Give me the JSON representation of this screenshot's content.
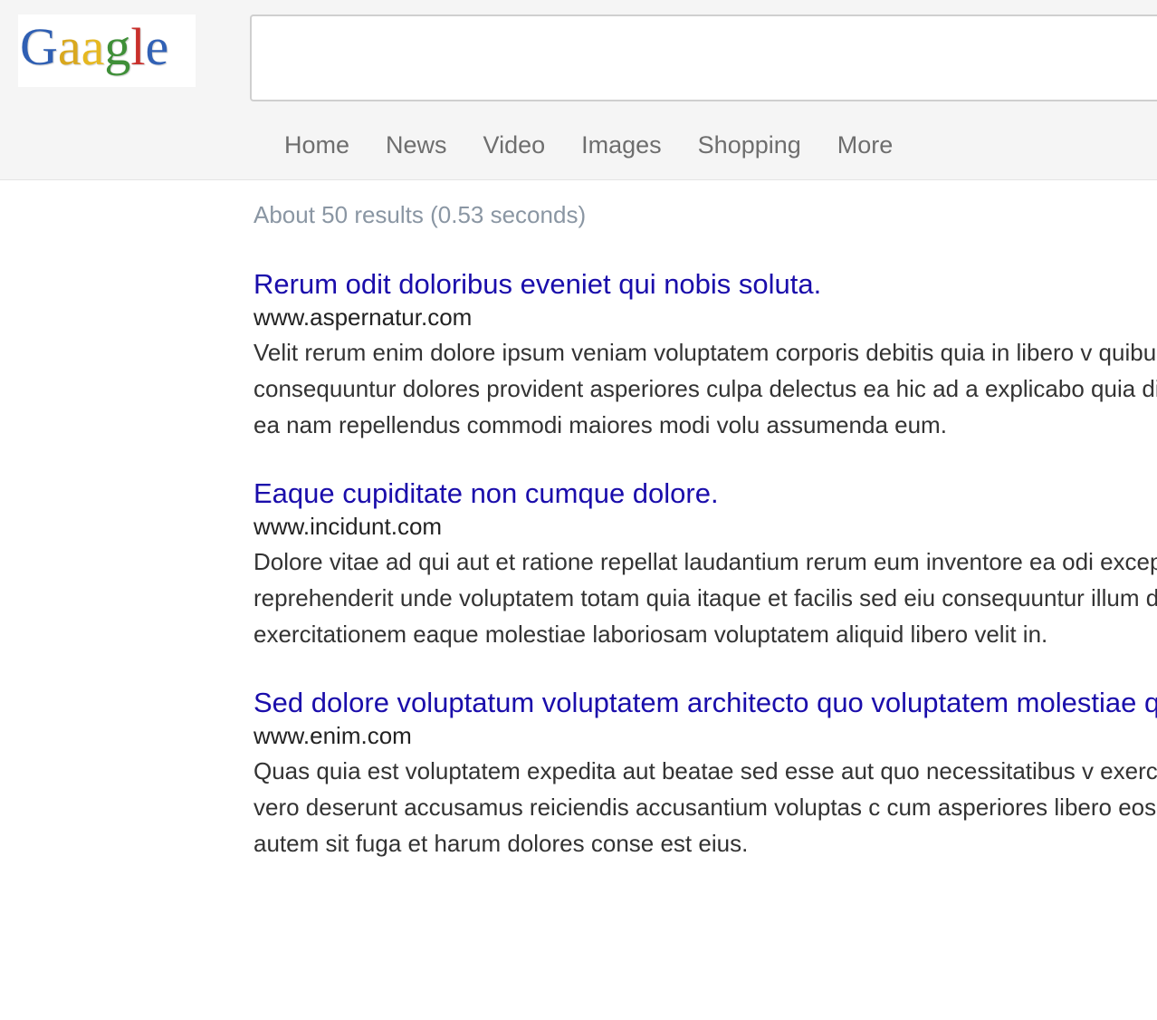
{
  "logo": {
    "letters": [
      {
        "char": "G",
        "color": "#2f5fb3"
      },
      {
        "char": "a",
        "color": "#d9a81e"
      },
      {
        "char": "a",
        "color": "#e6b820"
      },
      {
        "char": "g",
        "color": "#3f8f38"
      },
      {
        "char": "l",
        "color": "#c9302c"
      },
      {
        "char": "e",
        "color": "#3161b5"
      }
    ]
  },
  "search": {
    "value": "",
    "placeholder": ""
  },
  "nav": {
    "items": [
      "Home",
      "News",
      "Video",
      "Images",
      "Shopping",
      "More"
    ]
  },
  "stats": {
    "text": "About 50 results (0.53 seconds)"
  },
  "results": [
    {
      "title": "Rerum odit doloribus eveniet qui nobis soluta.",
      "url": "www.aspernatur.com",
      "snippet": "Velit rerum enim dolore ipsum veniam voluptatem corporis debitis quia in libero v quibusdam consequuntur dolores provident asperiores culpa delectus ea hic ad a explicabo quia dicta ut est vitae ea nam repellendus commodi maiores modi volu assumenda eum."
    },
    {
      "title": "Eaque cupiditate non cumque dolore.",
      "url": "www.incidunt.com",
      "snippet": "Dolore vitae ad qui aut et ratione repellat laudantium rerum eum inventore ea odi excepturi atque reprehenderit unde voluptatem totam quia itaque et facilis sed eiu consequuntur illum dolorum veniam exercitationem eaque molestiae laboriosam voluptatem aliquid libero velit in."
    },
    {
      "title": "Sed dolore voluptatum voluptatem architecto quo voluptatem molestiae quibusdam.",
      "url": "www.enim.com",
      "snippet": "Quas quia est voluptatem expedita aut beatae sed esse aut quo necessitatibus v exercitationem optio vero deserunt accusamus reiciendis accusantium voluptas c cum asperiores libero eos enim natus velit autem sit fuga et harum dolores conse est eius."
    }
  ]
}
